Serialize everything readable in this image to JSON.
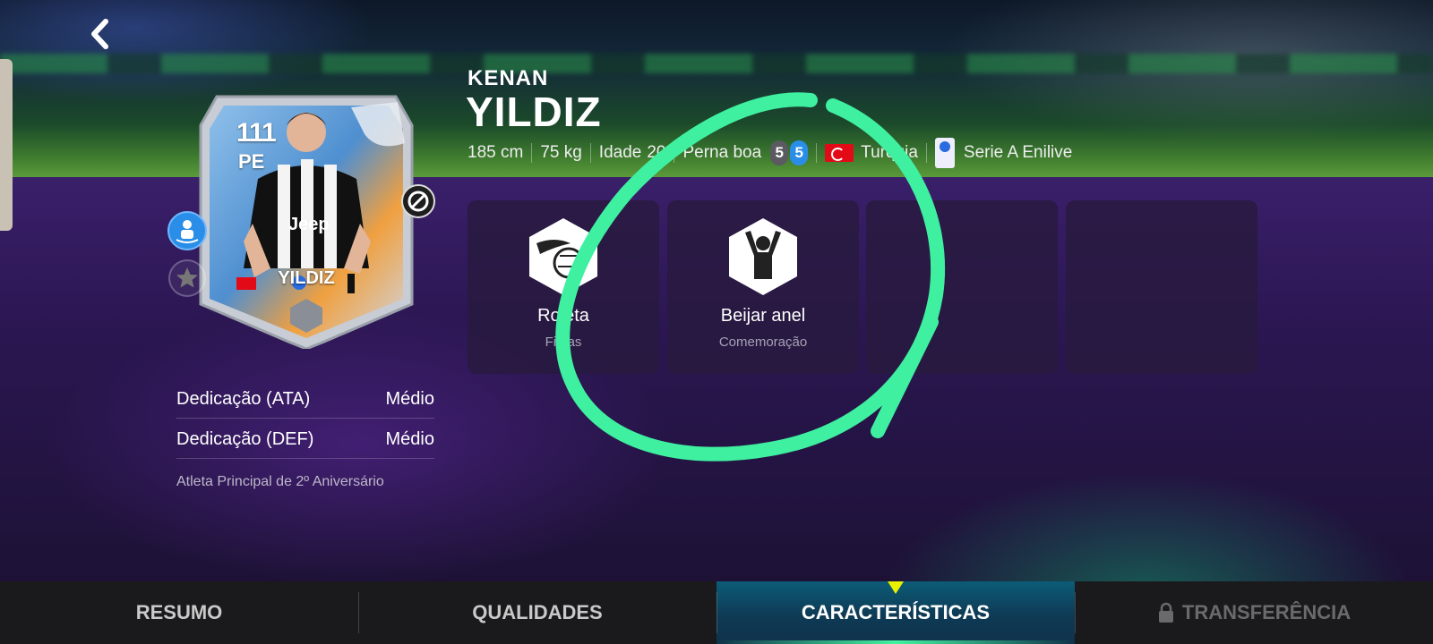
{
  "player": {
    "first_name": "KENAN",
    "last_name": "YILDIZ",
    "height": "185 cm",
    "weight": "75 kg",
    "age_label": "Idade",
    "age_value": "20",
    "foot_label": "Perna boa",
    "weak_foot": "5",
    "strong_foot": "5",
    "nationality": "Turquia",
    "league": "Serie A Enilive"
  },
  "card": {
    "ovr": "111",
    "position": "PE",
    "name": "YILDIZ",
    "sponsor": "Jeep"
  },
  "traits": [
    {
      "name": "Roleta",
      "category": "Fintas",
      "icon": "skill-move-icon"
    },
    {
      "name": "Beijar anel",
      "category": "Comemoração",
      "icon": "celebration-icon"
    }
  ],
  "work_rates": [
    {
      "label": "Dedicação (ATA)",
      "value": "Médio"
    },
    {
      "label": "Dedicação (DEF)",
      "value": "Médio"
    }
  ],
  "special_label": "Atleta Principal de 2º Aniversário",
  "tabs": [
    {
      "label": "RESUMO",
      "active": false,
      "locked": false
    },
    {
      "label": "QUALIDADES",
      "active": false,
      "locked": false
    },
    {
      "label": "CARACTERÍSTICAS",
      "active": true,
      "locked": false
    },
    {
      "label": "TRANSFERÊNCIA",
      "active": false,
      "locked": true
    }
  ],
  "colors": {
    "accent": "#45f2a0",
    "annotation": "#3ef0a0",
    "indicator": "#e8f200",
    "flag_red": "#e30a17"
  }
}
